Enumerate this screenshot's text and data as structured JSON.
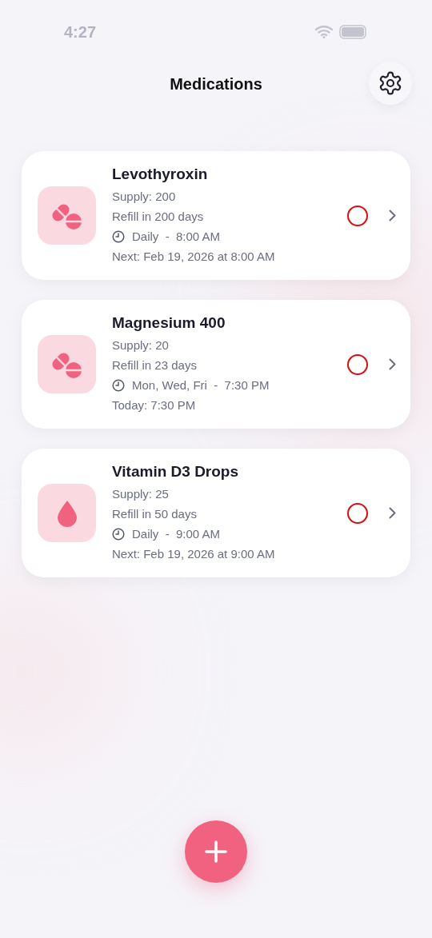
{
  "status_bar": {
    "time": "4:27"
  },
  "header": {
    "title": "Medications"
  },
  "medications": [
    {
      "name": "Levothyroxin",
      "kind": "pill",
      "supply": "Supply: 200",
      "refill": "Refill in 200 days",
      "schedule": "Daily  -  8:00 AM",
      "next": "Next: Feb 19, 2026 at 8:00 AM",
      "taken": false
    },
    {
      "name": "Magnesium 400",
      "kind": "pill",
      "supply": "Supply: 20",
      "refill": "Refill in 23 days",
      "schedule": "Mon, Wed, Fri  -  7:30 PM",
      "next": "Today: 7:30 PM",
      "taken": false
    },
    {
      "name": "Vitamin D3 Drops",
      "kind": "drop",
      "supply": "Supply: 25",
      "refill": "Refill in 50 days",
      "schedule": "Daily  -  9:00 AM",
      "next": "Next: Feb 19, 2026 at 9:00 AM",
      "taken": false
    }
  ]
}
